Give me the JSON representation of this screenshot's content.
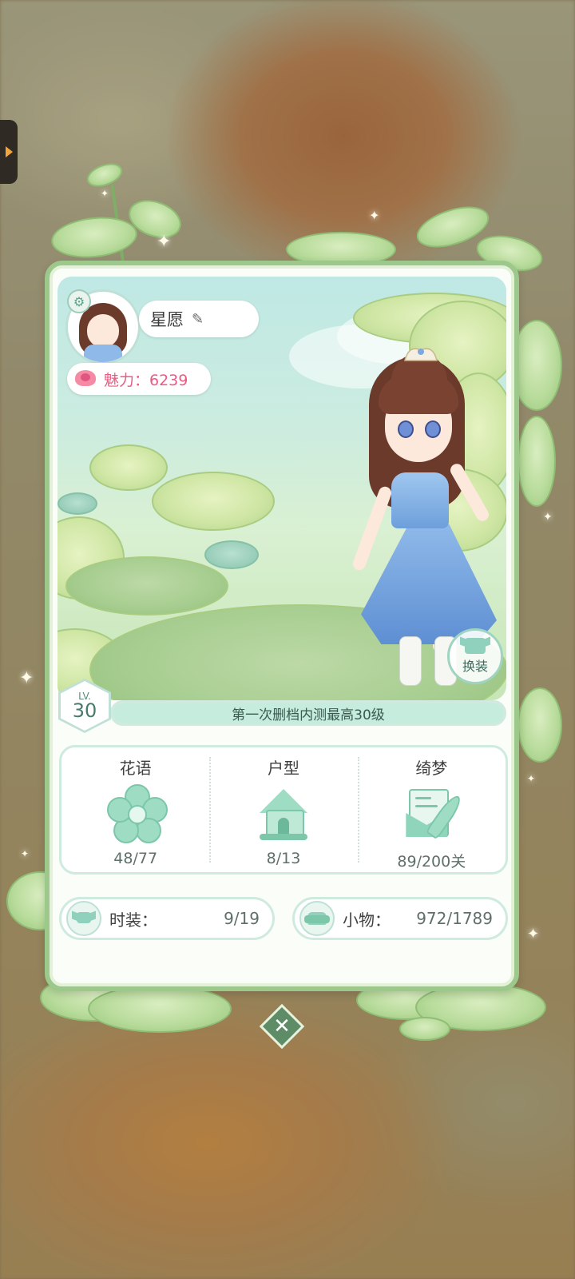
{
  "profile": {
    "name": "星愿",
    "charm_label": "魅力：6239"
  },
  "wardrobe_button": {
    "label": "换装"
  },
  "level": {
    "prefix": "LV.",
    "number": "30",
    "banner": "第一次删档内测最高30级"
  },
  "stats": [
    {
      "title": "花语",
      "value": "48/77",
      "icon": "flower-icon"
    },
    {
      "title": "户型",
      "value": "8/13",
      "icon": "house-icon"
    },
    {
      "title": "绮梦",
      "value": "89/200关",
      "icon": "letter-icon"
    }
  ],
  "collections": {
    "fashion": {
      "label": "时装：",
      "value": "9/19",
      "icon": "shirt-icon"
    },
    "items": {
      "label": "小物：",
      "value": "972/1789",
      "icon": "sofa-icon"
    }
  },
  "close_icon": "close-icon",
  "colors": {
    "card_border": "#9cc88b",
    "accent_mint": "#9fdcc4",
    "charm_pink": "#ec5a83"
  }
}
